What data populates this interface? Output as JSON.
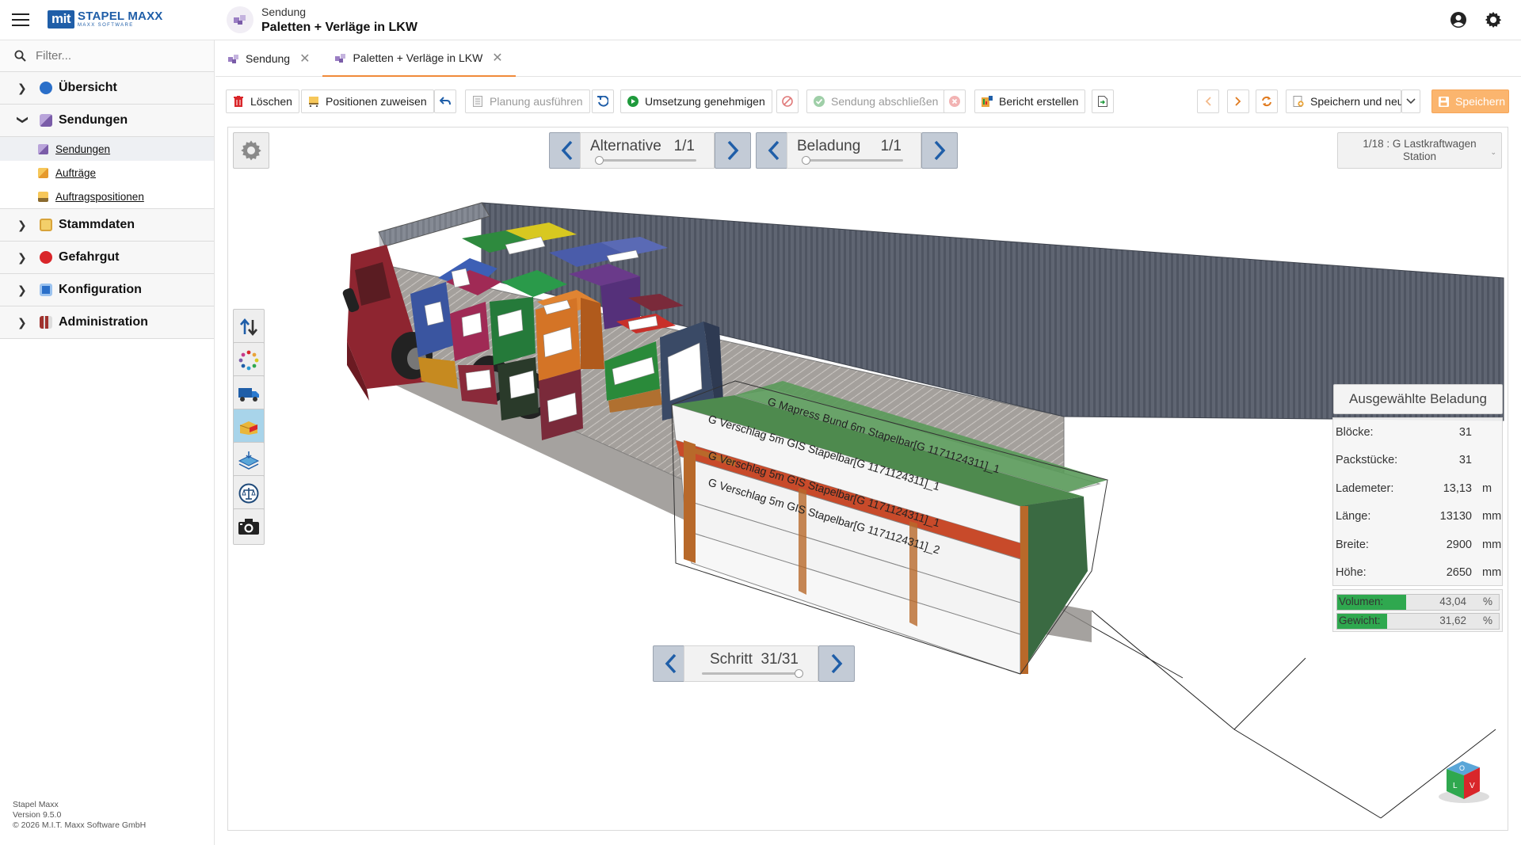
{
  "app": {
    "logo_mark": "mit",
    "logo_name": "STAPEL MAXX",
    "logo_sub": "MAXX SOFTWARE"
  },
  "header": {
    "doc_type": "Sendung",
    "doc_name": "Paletten + Verläge in LKW"
  },
  "sidebar": {
    "filter_placeholder": "Filter...",
    "groups": [
      {
        "label": "Übersicht",
        "icon": "globe-icon",
        "color": "#2a6fc9"
      },
      {
        "label": "Sendungen",
        "icon": "shipment-icon",
        "color": "#7a5ca8",
        "expanded": true
      },
      {
        "label": "Stammdaten",
        "icon": "master-data-icon",
        "color": "#e7b33a"
      },
      {
        "label": "Gefahrgut",
        "icon": "hazard-icon",
        "color": "#d9262a"
      },
      {
        "label": "Konfiguration",
        "icon": "config-icon",
        "color": "#2a6fc9"
      },
      {
        "label": "Administration",
        "icon": "admin-icon",
        "color": "#a0322e"
      }
    ],
    "sub_items": [
      {
        "label": "Sendungen",
        "active": true
      },
      {
        "label": "Aufträge"
      },
      {
        "label": "Auftragspositionen"
      }
    ],
    "version": [
      "Stapel Maxx",
      "Version 9.5.0",
      "© 2026 M.I.T. Maxx Software GmbH"
    ]
  },
  "tabs": [
    {
      "label": "Sendung",
      "active": false
    },
    {
      "label": "Paletten + Verläge in LKW",
      "active": true
    }
  ],
  "toolbar": {
    "delete": "Löschen",
    "assign": "Positionen zuweisen",
    "plan": "Planung ausführen",
    "approve": "Umsetzung genehmigen",
    "complete": "Sendung abschließen",
    "report": "Bericht erstellen",
    "save_new": "Speichern und neu",
    "save": "Speichern"
  },
  "viewer": {
    "alternative_label": "Alternative",
    "alternative_value": "1/1",
    "loading_label": "Beladung",
    "loading_value": "1/1",
    "step_label": "Schritt",
    "step_value": "31/31",
    "step_progress": 1.0,
    "station_line1": "1/18 : G Lastkraftwagen",
    "station_line2": "Station",
    "tools": [
      "sort-arrows-icon",
      "color-dots-icon",
      "truck-icon",
      "package-icon",
      "layers-icon",
      "scale-icon",
      "camera-icon"
    ]
  },
  "info": {
    "title": "Ausgewählte Beladung",
    "rows": [
      {
        "key": "Blöcke:",
        "value": "31",
        "unit": ""
      },
      {
        "key": "Packstücke:",
        "value": "31",
        "unit": ""
      },
      {
        "key": "Lademeter:",
        "value": "13,13",
        "unit": "m"
      },
      {
        "key": "Länge:",
        "value": "13130",
        "unit": "mm"
      },
      {
        "key": "Breite:",
        "value": "2900",
        "unit": "mm"
      },
      {
        "key": "Höhe:",
        "value": "2650",
        "unit": "mm"
      }
    ],
    "bars": [
      {
        "name": "Volumen:",
        "value": "43,04",
        "unit": "%",
        "fraction": 0.4304
      },
      {
        "name": "Gewicht:",
        "value": "31,62",
        "unit": "%",
        "fraction": 0.3162
      }
    ]
  },
  "cargo_labels": [
    "G Mapress Bund 6m Stapelbar[G 1171124311]_1",
    "G Verschlag 5m GIS Stapelbar[G 1171124311]_1",
    "G Verschlag 5m GIS Stapelbar[G 1171124311]_1",
    "G Verschlag 5m GIS Stapelbar[G 1171124311]_2"
  ]
}
